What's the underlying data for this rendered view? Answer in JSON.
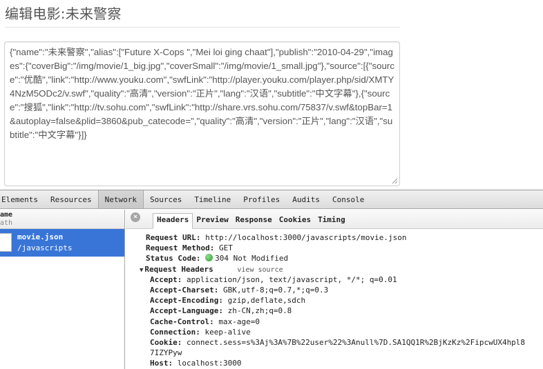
{
  "page": {
    "title": "编辑电影:未来警察",
    "json_text": "{\"name\":\"未来警察\",\"alias\":[\"Future X-Cops \",\"Mei loi ging chaat\"],\"publish\":\"2010-04-29\",\"images\":{\"coverBig\":\"/img/movie/1_big.jpg\",\"coverSmall\":\"/img/movie/1_small.jpg\"},\"source\":[{\"source\":\"优酷\",\"link\":\"http://www.youku.com\",\"swfLink\":\"http://player.youku.com/player.php/sid/XMTY4NzM5ODc2/v.swf\",\"quality\":\"高清\",\"version\":\"正片\",\"lang\":\"汉语\",\"subtitle\":\"中文字幕\"},{\"source\":\"搜狐\",\"link\":\"http://tv.sohu.com\",\"swfLink\":\"http://share.vrs.sohu.com/75837/v.swf&topBar=1&autoplay=false&plid=3860&pub_catecode=\",\"quality\":\"高清\",\"version\":\"正片\",\"lang\":\"汉语\",\"subtitle\":\"中文字幕\"}]}"
  },
  "devtools": {
    "tabs": [
      "Elements",
      "Resources",
      "Network",
      "Sources",
      "Timeline",
      "Profiles",
      "Audits",
      "Console"
    ],
    "active_tab": "Network",
    "columns": {
      "name": "ame",
      "path": "ath"
    },
    "request": {
      "name": "movie.json",
      "path": "/javascripts"
    },
    "detail_tabs": [
      "Headers",
      "Preview",
      "Response",
      "Cookies",
      "Timing"
    ],
    "active_detail_tab": "Headers",
    "close_glyph": "×",
    "general": {
      "url_key": "Request URL:",
      "url_val": "http://localhost:3000/javascripts/movie.json",
      "method_key": "Request Method:",
      "method_val": "GET",
      "status_key": "Status Code:",
      "status_val": "304 Not Modified"
    },
    "request_headers_title": "Request Headers",
    "view_source": "view source",
    "headers": [
      {
        "k": "Accept:",
        "v": "application/json, text/javascript, */*; q=0.01"
      },
      {
        "k": "Accept-Charset:",
        "v": "GBK,utf-8;q=0.7,*;q=0.3"
      },
      {
        "k": "Accept-Encoding:",
        "v": "gzip,deflate,sdch"
      },
      {
        "k": "Accept-Language:",
        "v": "zh-CN,zh;q=0.8"
      },
      {
        "k": "Cache-Control:",
        "v": "max-age=0"
      },
      {
        "k": "Connection:",
        "v": "keep-alive"
      },
      {
        "k": "Cookie:",
        "v": "connect.sess=s%3Aj%3A%7B%22user%22%3Anull%7D.SA1QQ1R%2BjKzKz%2FipcwUX4hpl8"
      },
      {
        "k": "",
        "v": "7IZYPyw"
      },
      {
        "k": "Host:",
        "v": "localhost:3000"
      }
    ]
  }
}
